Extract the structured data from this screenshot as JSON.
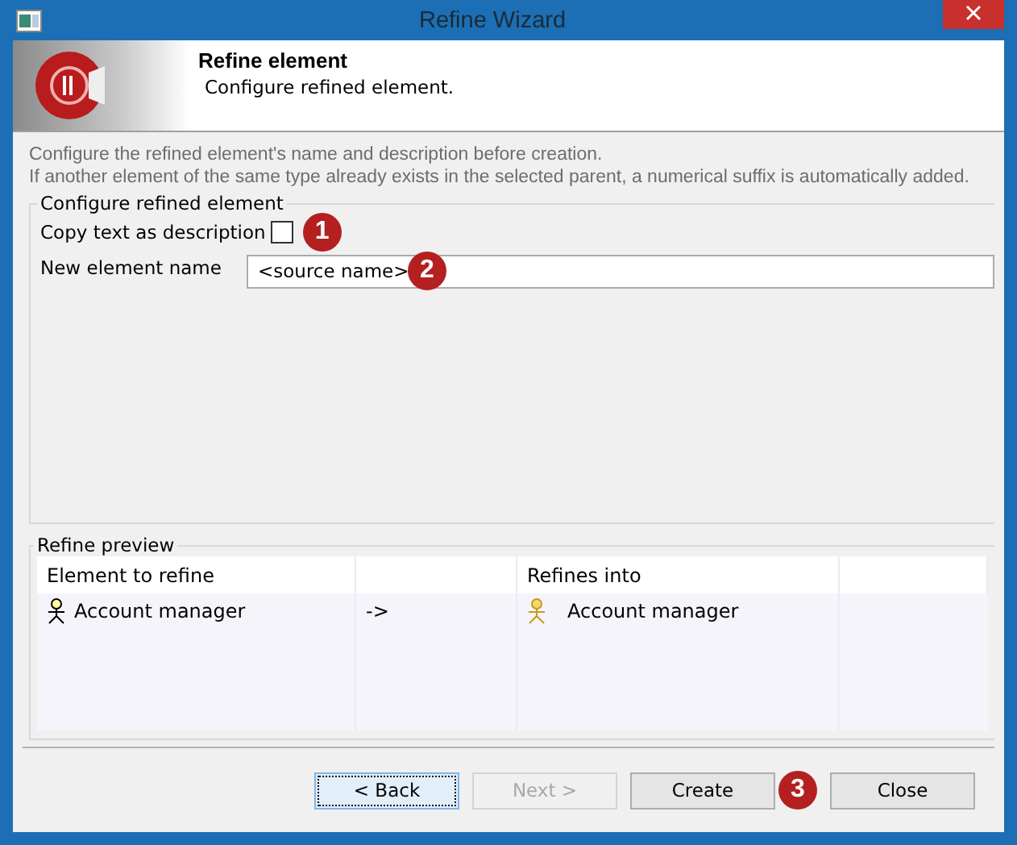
{
  "window": {
    "title": "Refine Wizard"
  },
  "banner": {
    "title": "Refine element",
    "subtitle": "Configure refined element."
  },
  "description": [
    "Configure the refined element's name and description before creation.",
    "If another element of the same type already exists in the selected parent, a numerical suffix is automatically added."
  ],
  "config_group": {
    "title": "Configure refined element",
    "copy_text": {
      "label": "Copy text as description",
      "checked": false,
      "callout": "1"
    },
    "name_field": {
      "label": "New element name",
      "value": "<source name>",
      "callout": "2"
    }
  },
  "preview_group": {
    "title": "Refine preview",
    "columns": [
      {
        "label": "Element to refine"
      },
      {},
      {
        "label": "Refines into"
      },
      {}
    ],
    "rows": [
      {
        "source": "Account manager",
        "arrow": "->",
        "target": "Account manager"
      }
    ]
  },
  "buttons": [
    {
      "label": "< Back",
      "focused": true,
      "disabled": false
    },
    {
      "label": "Next >",
      "focused": false,
      "disabled": true
    },
    {
      "label": "Create",
      "focused": false,
      "disabled": false,
      "callout": "3"
    },
    {
      "label": "Close",
      "focused": false,
      "disabled": false
    }
  ]
}
